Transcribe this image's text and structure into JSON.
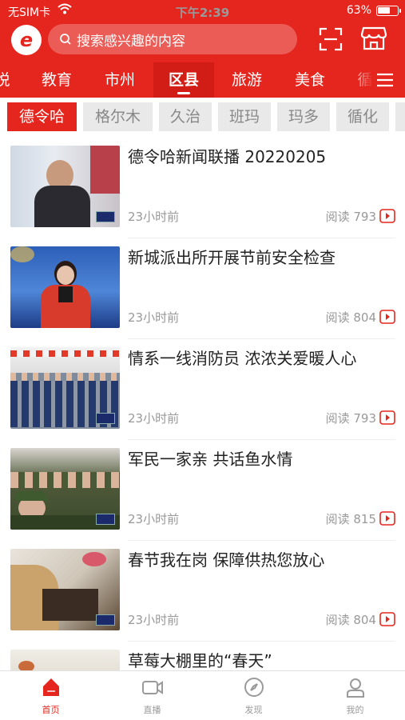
{
  "status_bar": {
    "carrier": "无SIM卡",
    "time": "下午2:39",
    "battery": "63%",
    "battery_level": 0.63
  },
  "header": {
    "logo_icon": "app-logo-icon",
    "search_placeholder": "搜索感兴趣的内容",
    "scan_icon": "scan-icon",
    "shop_icon": "shop-icon"
  },
  "tabs": [
    {
      "label": "悦"
    },
    {
      "label": "教育"
    },
    {
      "label": "市州"
    },
    {
      "label": "区县",
      "active": true
    },
    {
      "label": "旅游"
    },
    {
      "label": "美食"
    },
    {
      "label": "循"
    }
  ],
  "subtabs": [
    {
      "label": "德令哈",
      "active": true
    },
    {
      "label": "格尔木"
    },
    {
      "label": "久治"
    },
    {
      "label": "班玛"
    },
    {
      "label": "玛多"
    },
    {
      "label": "循化"
    }
  ],
  "articles": [
    {
      "title": "德令哈新闻联播 20220205",
      "time": "23小时前",
      "reads": "阅读 793"
    },
    {
      "title": "新城派出所开展节前安全检查",
      "time": "23小时前",
      "reads": "阅读 804"
    },
    {
      "title": "情系一线消防员 浓浓关爱暖人心",
      "time": "23小时前",
      "reads": "阅读 793"
    },
    {
      "title": "军民一家亲 共话鱼水情",
      "time": "23小时前",
      "reads": "阅读 815"
    },
    {
      "title": "春节我在岗 保障供热您放心",
      "time": "23小时前",
      "reads": "阅读 804"
    },
    {
      "title": "草莓大棚里的“春天”",
      "time": "",
      "reads": ""
    }
  ],
  "bottom_nav": [
    {
      "label": "首页",
      "icon": "home-icon",
      "active": true
    },
    {
      "label": "直播",
      "icon": "live-video-icon"
    },
    {
      "label": "发现",
      "icon": "compass-icon"
    },
    {
      "label": "我的",
      "icon": "profile-icon"
    }
  ],
  "colors": {
    "brand_red": "#e5261e",
    "active_tab_bg": "#d11d15",
    "muted_text": "#999999"
  }
}
